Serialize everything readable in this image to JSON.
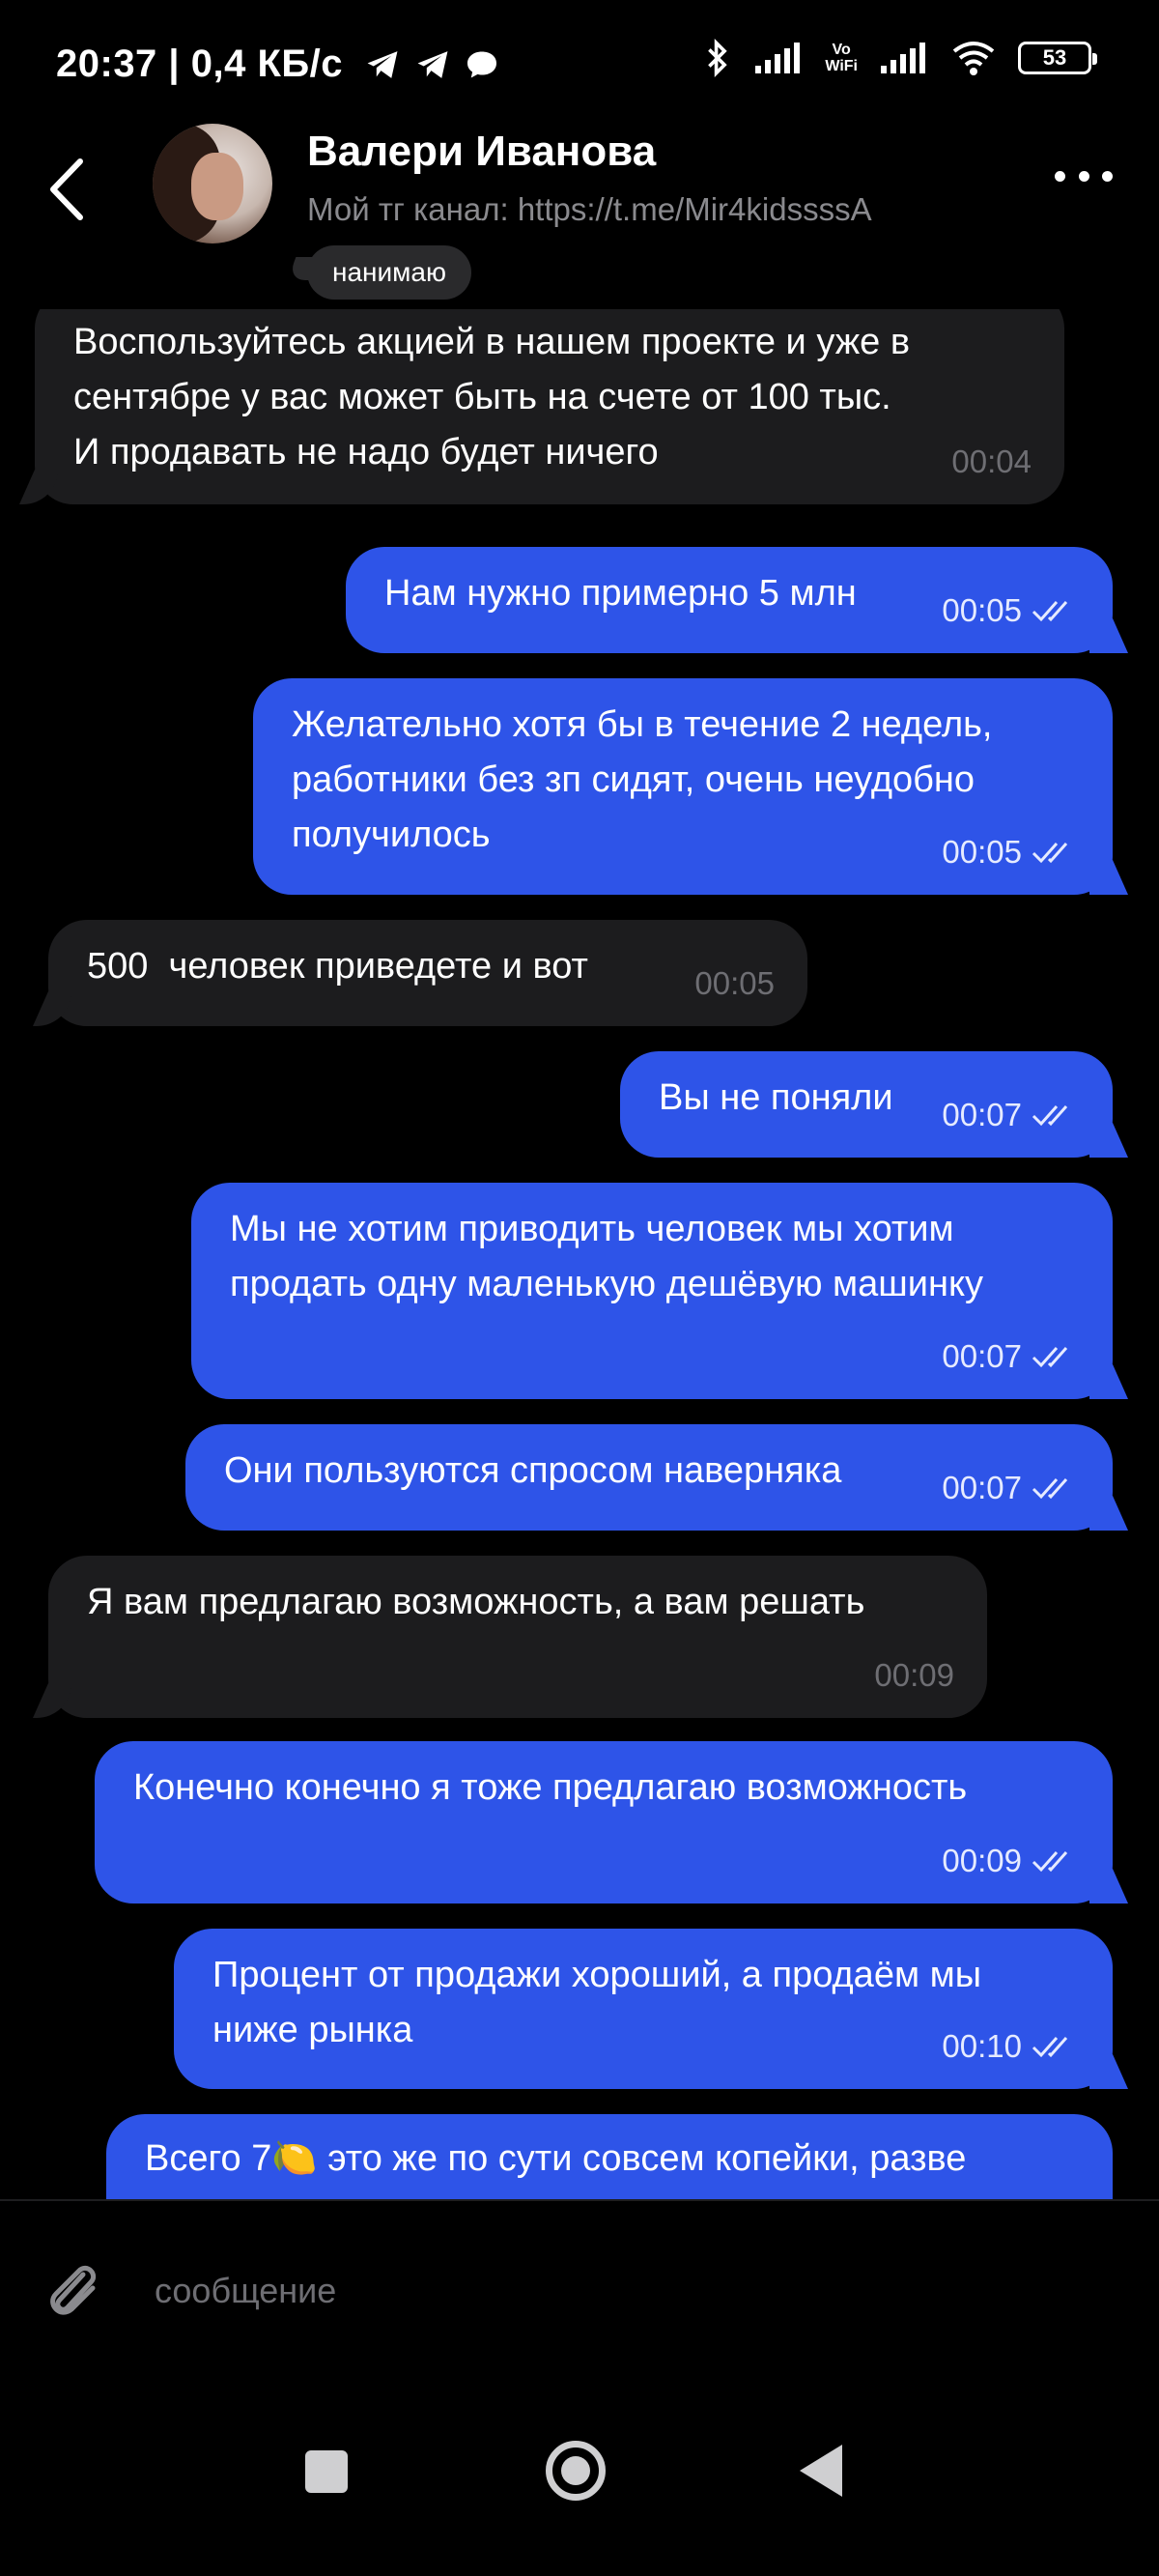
{
  "status_bar": {
    "time_speed": "20:37 | 0,4 КБ/с",
    "vowifi_line1": "Vo",
    "vowifi_line2": "WiFi",
    "battery": "53"
  },
  "header": {
    "back_icon": "chevron-left-icon",
    "name": "Валери Иванова",
    "subtitle": "Мой тг канал: https://t.me/Mir4kidssssA",
    "typing_chip": "нанимаю",
    "more_icon": "more-dots-icon"
  },
  "messages": [
    {
      "dir": "in",
      "text": "Воспользуйтесь акцией в нашем проекте и уже в\nсентябре у вас может быть на счете от 100 тыс.\nИ продавать не надо будет ничего",
      "time": "00:04"
    },
    {
      "dir": "out",
      "text": "Нам нужно примерно 5 млн",
      "time": "00:05"
    },
    {
      "dir": "out",
      "text": "Желательно хотя бы в течение 2 недель,\nработники без зп сидят, очень неудобно\nполучилось",
      "time": "00:05"
    },
    {
      "dir": "in",
      "text": "500  человек приведете и вот",
      "time": "00:05"
    },
    {
      "dir": "out",
      "text": "Вы не поняли",
      "time": "00:07"
    },
    {
      "dir": "out",
      "text": "Мы не хотим приводить человек мы хотим\nпродать одну маленькую дешёвую машинку",
      "time": "00:07"
    },
    {
      "dir": "out",
      "text": "Они пользуются спросом наверняка",
      "time": "00:07"
    },
    {
      "dir": "in",
      "text": "Я вам предлагаю возможность, а вам решать",
      "time": "00:09"
    },
    {
      "dir": "out",
      "text": "Конечно конечно я тоже предлагаю возможность",
      "time": "00:09"
    },
    {
      "dir": "out",
      "text": "Процент от продажи хороший, а продаём мы\nниже рынка",
      "time": "00:10"
    },
    {
      "dir": "out",
      "text": "Всего 7🍋 это же по сути совсем копейки, разве",
      "time": ""
    }
  ],
  "input": {
    "placeholder": "сообщение",
    "attach_icon": "paperclip-icon"
  },
  "nav": {
    "recents_icon": "square-icon",
    "home_icon": "circle-home-icon",
    "back_icon": "triangle-back-icon"
  },
  "colors": {
    "background": "#000000",
    "incoming_bubble": "#1c1c1e",
    "outgoing_bubble": "#2e54e8",
    "muted_text": "#6e6e73"
  }
}
